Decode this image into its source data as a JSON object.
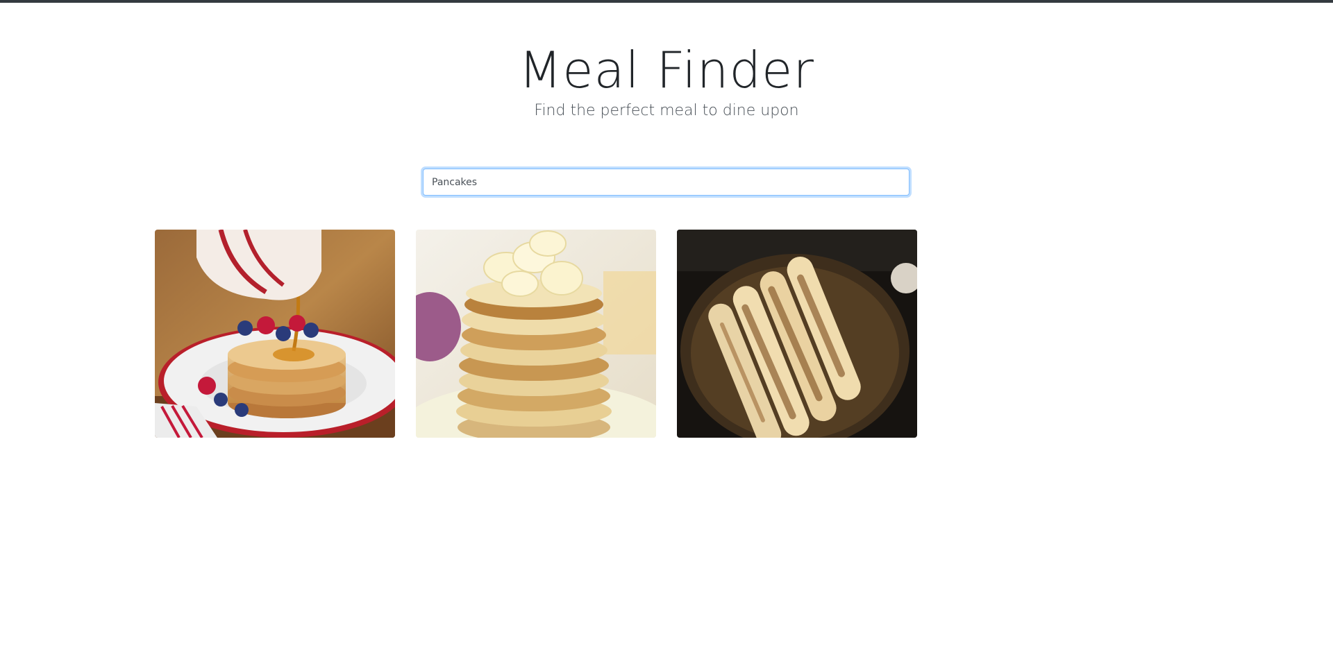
{
  "header": {
    "title": "Meal Finder",
    "subtitle": "Find the perfect meal to dine upon"
  },
  "search": {
    "value": "Pancakes",
    "placeholder": ""
  },
  "results": [
    {
      "image": "pancake-stack-with-syrup-and-berries"
    },
    {
      "image": "banana-pancake-stack"
    },
    {
      "image": "rolled-crepes-on-dark-plate"
    }
  ],
  "colors": {
    "top_bar": "#343a40",
    "focus_border": "#80bdff",
    "title_text": "#212529"
  }
}
